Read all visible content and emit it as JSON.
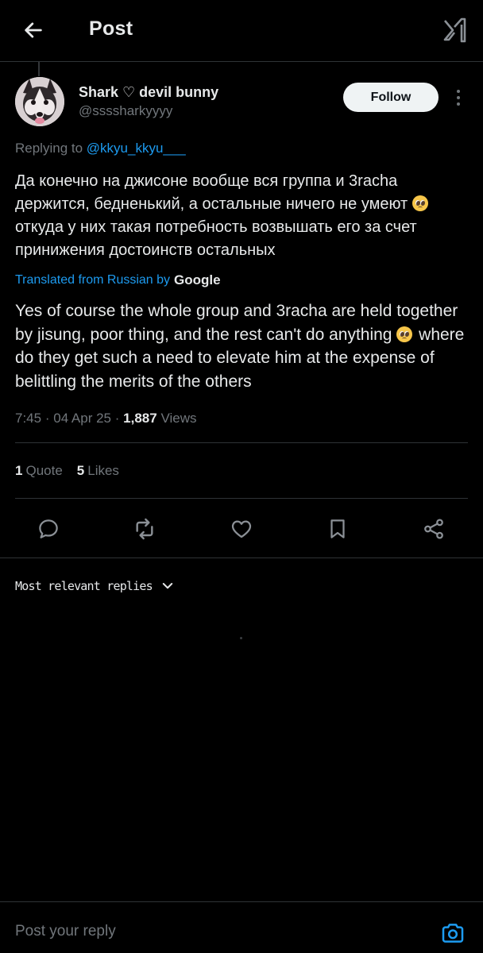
{
  "header": {
    "title": "Post"
  },
  "author": {
    "display_name": "Shark ♡ devil bunny",
    "handle": "@ssssharkyyyy",
    "follow_label": "Follow"
  },
  "post": {
    "replying_label": "Replying to ",
    "replying_to": "@kkyu_kkyu___",
    "text_part1": "Да конечно на джисоне вообще вся группа и 3racha держится, бедненький, а остальные ничего не умеют ",
    "text_part2": "откуда у них такая потребность возвышать его за счет принижения достоинств остальных",
    "translated_label": "Translated from Russian by",
    "translated_provider": "Google",
    "translation_part1": "Yes of course the whole group and 3racha are held together by jisung, poor thing, and the rest can't do anything ",
    "translation_part2": " where do they get such a need to elevate him at the expense of belittling the merits of the others",
    "time": "7:45",
    "date": "04 Apr 25",
    "views_count": "1,887",
    "views_label": "Views",
    "separator": "·"
  },
  "stats": {
    "quotes_count": "1",
    "quotes_label": "Quote",
    "likes_count": "5",
    "likes_label": "Likes"
  },
  "actions": {
    "icons": [
      "reply-icon",
      "repost-icon",
      "like-icon",
      "bookmark-icon",
      "share-icon"
    ]
  },
  "replies": {
    "sort_label": "Most relevant replies"
  },
  "composer": {
    "placeholder": "Post your reply"
  },
  "colors": {
    "background": "#000000",
    "text": "#e7e9ea",
    "muted": "#71767b",
    "accent": "#1d9bf0",
    "divider": "#2f3336"
  }
}
